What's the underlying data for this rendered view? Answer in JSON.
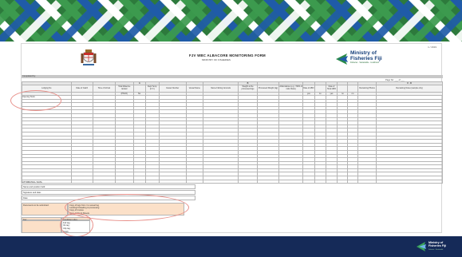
{
  "form": {
    "number": "1 / 2019",
    "title": "FJV WBC ALBACORE MONITORING FORM",
    "subtitle": "MINISTRY OF FISHERIES",
    "completed_by_label": "Completed by:",
    "page_label": "Page No:  ___ of ___"
  },
  "ministry": {
    "name_line1": "Ministry of",
    "name_line2": "Fisheries Fiji",
    "tagline": "Fisheries · Sustainable · Livelihood"
  },
  "table": {
    "band": [
      "",
      "",
      "",
      "",
      "A",
      "",
      "",
      "",
      "",
      "B",
      "",
      "",
      "",
      "",
      "",
      "",
      "",
      "",
      "C - D"
    ],
    "headers": [
      "Lodging No",
      "Date of Catch",
      "Time of Arrival",
      "Total Albacore landed",
      "",
      "Dept Temp (m°c)",
      "Vessel Number",
      "Vessel Name",
      "Name Fishing Grounds",
      "Weight at the processed Age",
      "Processed Weight (kg)",
      "Abdundance (e.g. >50% of ratio Class)",
      "Date of ABO",
      "",
      "Date of Hook ABO",
      "",
      "",
      "Remaining Photos",
      "Remaining Notes (sample only)"
    ],
    "subheaders": [
      "",
      "",
      "",
      "(PSCO)",
      "No.",
      "",
      "",
      "",
      "",
      "",
      "",
      "",
      "yes",
      "no",
      "yes",
      "no",
      "no",
      "",
      ""
    ],
    "first_row_label": "Opening Stock",
    "row_count": 24
  },
  "bottom": {
    "sig_title": "ATTRIBUTES / DATA",
    "sig_fields": [
      "Name and position held:",
      "Signature and date:"
    ],
    "date_label": "Date:",
    "doc_label": "Documents to be submitted:",
    "doc_items": [
      "Copy of logs from / to vessel log",
      "Landing/Unloading & processing",
      "Copy of Invoice",
      "Copy of Stock Sheets"
    ],
    "key_title": "Key",
    "key_header": "Condition index",
    "key_items": [
      "Full tag",
      "Ok tag",
      "Clip tag",
      "Spoilt"
    ]
  },
  "footer": {
    "name_line1": "Ministry of",
    "name_line2": "Fisheries Fiji",
    "tagline": "Fisheries · Sustainable"
  },
  "colors": {
    "banner_green": "#2a6f3a",
    "banner_blue": "#1f5ba8",
    "footer_navy": "#152a58",
    "highlight": "#e8908a",
    "peach": "#fbe0c8"
  }
}
